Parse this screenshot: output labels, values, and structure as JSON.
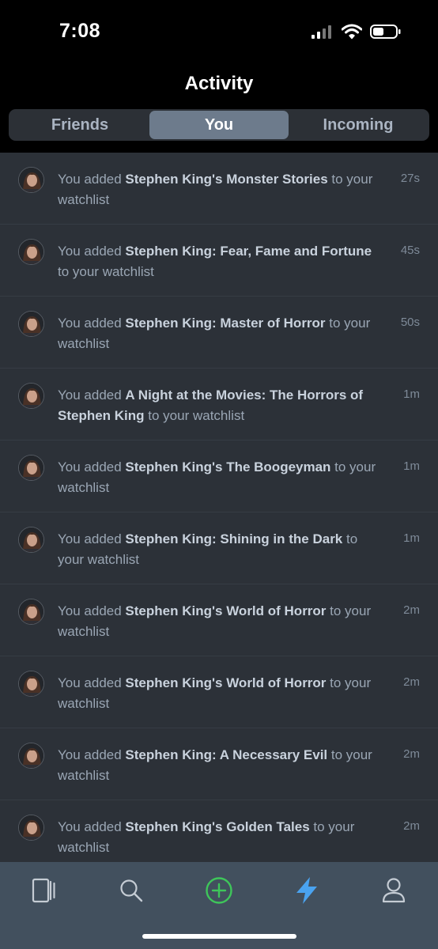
{
  "status_bar": {
    "time": "7:08"
  },
  "header": {
    "title": "Activity"
  },
  "segments": [
    {
      "label": "Friends",
      "active": false
    },
    {
      "label": "You",
      "active": true
    },
    {
      "label": "Incoming",
      "active": false
    }
  ],
  "activity": [
    {
      "prefix": "You added ",
      "title": "Stephen King's Monster Stories",
      "suffix": " to your watchlist",
      "time": "27s"
    },
    {
      "prefix": "You added ",
      "title": "Stephen King: Fear, Fame and Fortune",
      "suffix": " to your watchlist",
      "time": "45s"
    },
    {
      "prefix": "You added ",
      "title": "Stephen King: Master of Horror",
      "suffix": " to your watchlist",
      "time": "50s"
    },
    {
      "prefix": "You added ",
      "title": "A Night at the Movies: The Horrors of Stephen King",
      "suffix": " to your watchlist",
      "time": "1m"
    },
    {
      "prefix": "You added ",
      "title": "Stephen King's The Boogeyman",
      "suffix": " to your watchlist",
      "time": "1m"
    },
    {
      "prefix": "You added ",
      "title": "Stephen King: Shining in the Dark",
      "suffix": " to your watchlist",
      "time": "1m"
    },
    {
      "prefix": "You added ",
      "title": "Stephen King's World of Horror",
      "suffix": " to your watchlist",
      "time": "2m"
    },
    {
      "prefix": "You added ",
      "title": "Stephen King's World of Horror",
      "suffix": " to your watchlist",
      "time": "2m"
    },
    {
      "prefix": "You added ",
      "title": "Stephen King: A Necessary Evil",
      "suffix": " to your watchlist",
      "time": "2m"
    },
    {
      "prefix": "You added ",
      "title": "Stephen King's Golden Tales",
      "suffix": " to your watchlist",
      "time": "2m"
    }
  ],
  "tab_bar": {
    "items": [
      {
        "icon": "library-icon",
        "active": false
      },
      {
        "icon": "search-icon",
        "active": false
      },
      {
        "icon": "add-circle-icon",
        "active": false
      },
      {
        "icon": "lightning-icon",
        "active": true
      },
      {
        "icon": "profile-icon",
        "active": false
      }
    ]
  },
  "colors": {
    "background": "#000000",
    "list_background": "#2c3138",
    "segment_active": "#6d7b8c",
    "tab_bar": "#42505e",
    "add_accent": "#3ec65a",
    "activity_accent": "#4aa3f0"
  }
}
